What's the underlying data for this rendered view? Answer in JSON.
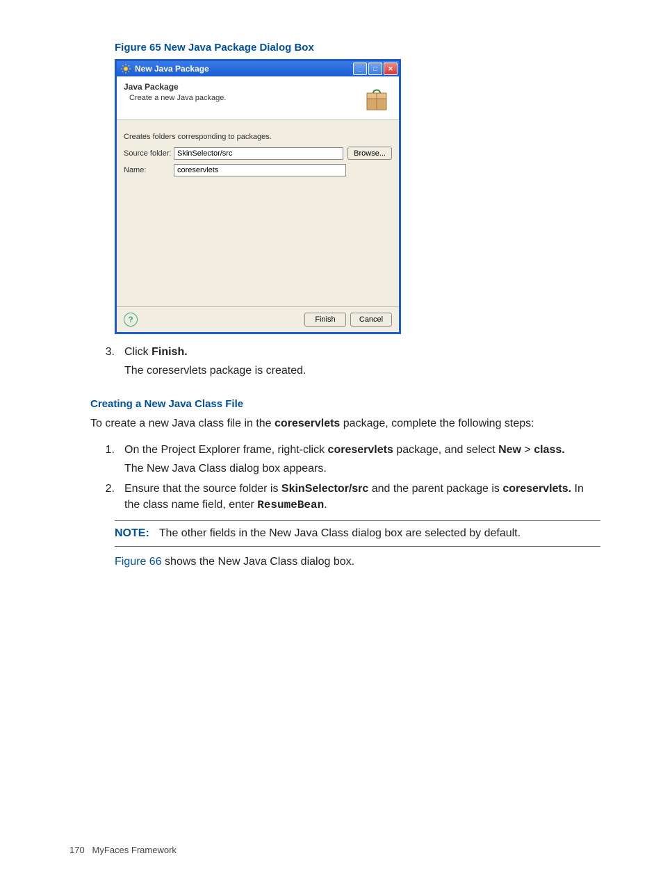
{
  "figure_caption": "Figure 65 New Java Package Dialog Box",
  "dialog": {
    "title": "New Java Package",
    "banner_title": "Java Package",
    "banner_desc": "Create a new Java package.",
    "body_note": "Creates folders corresponding to packages.",
    "source_label": "Source folder:",
    "source_value": "SkinSelector/src",
    "browse_label": "Browse...",
    "name_label": "Name:",
    "name_value": "coreservlets",
    "finish": "Finish",
    "cancel": "Cancel"
  },
  "step3": {
    "num": "3.",
    "line1_a": "Click ",
    "line1_b": "Finish.",
    "line2": "The coreservlets package is created."
  },
  "section_heading": "Creating a New Java Class File",
  "intro_a": "To create a new Java class file in the ",
  "intro_b": "coreservlets",
  "intro_c": " package, complete the following steps:",
  "s1": {
    "num": "1.",
    "a": "On the Project Explorer frame, right-click ",
    "b": "coreservlets",
    "c": " package, and select ",
    "d": "New",
    "e": " > ",
    "f": "class.",
    "sub": "The New Java Class dialog box appears."
  },
  "s2": {
    "num": "2.",
    "a": "Ensure that the source folder is ",
    "b": "SkinSelector/src",
    "c": " and the parent package is ",
    "d": "coreservlets.",
    "e": " In the class name field, enter ",
    "f": "ResumeBean",
    "g": "."
  },
  "note": {
    "label": "NOTE:",
    "text": "The other fields in the New Java Class dialog box are selected by default."
  },
  "post_note_a": "Figure 66",
  "post_note_b": " shows the New Java Class dialog box.",
  "page_footer": {
    "num": "170",
    "title": "MyFaces Framework"
  }
}
